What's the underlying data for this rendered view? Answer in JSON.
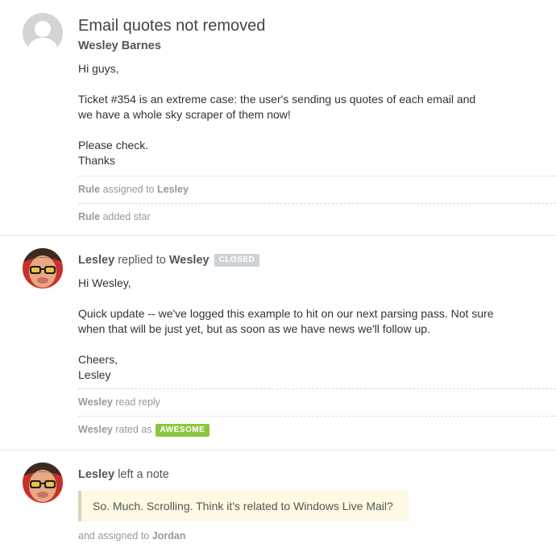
{
  "thread": {
    "subject": "Email quotes not removed",
    "first_message": {
      "author": "Wesley Barnes",
      "lines": [
        "Hi guys,",
        "",
        "Ticket #354 is an extreme case: the user's sending us quotes of each email and",
        "we have a whole sky scraper of them now!",
        "",
        "Please check.",
        "Thanks"
      ],
      "activities": [
        {
          "actor": "Rule",
          "action": "assigned to",
          "target": "Lesley"
        },
        {
          "actor": "Rule",
          "action": "added star",
          "target": ""
        }
      ]
    },
    "reply": {
      "author": "Lesley",
      "verb": "replied to",
      "recipient": "Wesley",
      "status_badge": "CLOSED",
      "lines": [
        "Hi Wesley,",
        "",
        "Quick update -- we've logged this example to hit on our next parsing pass. Not sure",
        "when that will be just yet, but as soon as we have news we'll follow up.",
        "",
        "Cheers,",
        "Lesley"
      ],
      "activities": [
        {
          "actor": "Wesley",
          "action": "read reply"
        },
        {
          "actor": "Wesley",
          "action": "rated as",
          "rating": "AWESOME"
        }
      ]
    },
    "note": {
      "author": "Lesley",
      "verb": "left a note",
      "text": "So. Much. Scrolling. Think it's related to Windows Live Mail?",
      "assign_prefix": "and assigned to",
      "assignee": "Jordan"
    }
  },
  "colors": {
    "closed_badge": "#cdd3d8",
    "awesome_badge": "#8cc63f",
    "note_background": "#fdf9e3",
    "avatar_default": "#cfcfcf"
  }
}
